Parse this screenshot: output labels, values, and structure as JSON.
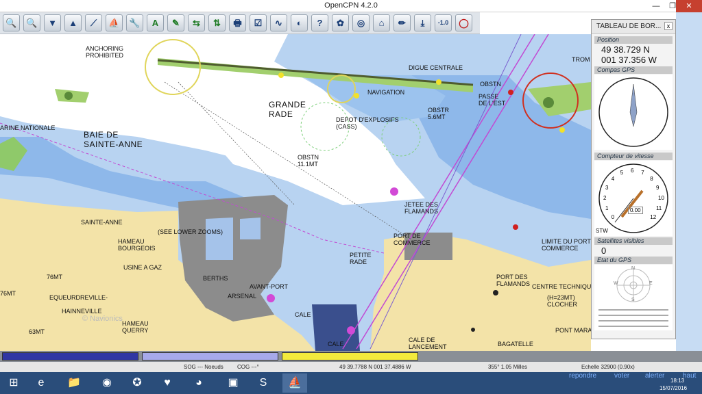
{
  "window": {
    "title": "OpenCPN 4.2.0",
    "minimize": "—",
    "maximize": "❐",
    "close": "✕"
  },
  "toolbar": [
    {
      "icon": "zoom-in-icon",
      "glyph": "🔍"
    },
    {
      "icon": "zoom-out-icon",
      "glyph": "🔍"
    },
    {
      "icon": "scale-in-icon",
      "glyph": "▼"
    },
    {
      "icon": "scale-out-icon",
      "glyph": "▲"
    },
    {
      "icon": "route-icon",
      "glyph": "⟋"
    },
    {
      "icon": "auto-follow-icon",
      "glyph": "⛵"
    },
    {
      "icon": "settings-icon",
      "glyph": "🔧"
    },
    {
      "icon": "text-icon",
      "glyph": "A"
    },
    {
      "icon": "tides-icon",
      "glyph": "✎"
    },
    {
      "icon": "currents-icon",
      "glyph": "⇆"
    },
    {
      "icon": "ais-icon",
      "glyph": "⇅"
    },
    {
      "icon": "print-icon",
      "glyph": "🖶"
    },
    {
      "icon": "route-manager-icon",
      "glyph": "☑"
    },
    {
      "icon": "track-icon",
      "glyph": "∿"
    },
    {
      "icon": "color-scheme-icon",
      "glyph": "◐"
    },
    {
      "icon": "help-icon",
      "glyph": "?"
    },
    {
      "icon": "plugin-icon",
      "glyph": "✿"
    },
    {
      "icon": "dashboard-icon",
      "glyph": "◎"
    },
    {
      "icon": "grib-icon",
      "glyph": "⌂"
    },
    {
      "icon": "measure-icon",
      "glyph": "✏"
    },
    {
      "icon": "download-icon",
      "glyph": "⤓"
    },
    {
      "icon": "version-icon",
      "glyph": "-1.0"
    },
    {
      "icon": "mob-icon",
      "glyph": "◯"
    }
  ],
  "chart_labels": {
    "anchoring": "ANCHORING\nPROHIBITED",
    "grande_rade": "GRANDE\nRADE",
    "baie": "BAIE DE\nSAINTE-ANNE",
    "marine": "ARINE NATIONALE",
    "digue": "DIGUE CENTRALE",
    "navigation": "NAVIGATION",
    "depot": "DEPOT D'EXPLOSIFS\n(CASS)",
    "obstn1": "OBSTN\n11.1MT",
    "obstr": "OBSTR\n5.6MT",
    "obstn2": "OBSTN",
    "passe": "PASSE\nDE L'EST",
    "sainte_anne": "SAINTE-ANNE",
    "see_lower": "(SEE LOWER ZOOMS)",
    "hameau_b": "HAMEAU\nBOURGEOIS",
    "usine": "USINE A GAZ",
    "berths": "BERTHS",
    "arsenal": "ARSENAL",
    "avant_port": "AVANT-PORT",
    "equeurdreville": "EQUEURDREVILLE-",
    "hainneville": "HAINNEVILLE",
    "hameau_q": "HAMEAU\nQUERRY",
    "mt76": "76MT",
    "mt63": "63MT",
    "mt76b": "76MT",
    "cale1": "CALE",
    "cale2": "CALE",
    "cale_lancement": "CALE DE\nLANCEMENT",
    "jetee": "JETEE DES\nFLAMANDS",
    "port_commerce": "PORT DE\nCOMMERCE",
    "petite_rade": "PETITE\nRADE",
    "limite": "LIMITE DU PORT DE\nCOMMERCE",
    "port_flamands": "PORT DES\nFLAMANDS",
    "centre_technique": "CENTRE TECHNIQUE",
    "clocher": "(H=23MT)\nCLOCHER",
    "pont_marais": "PONT MARAI",
    "bagatelle": "BAGATELLE",
    "navionics": "© Navionics",
    "troms": "TROM"
  },
  "dashboard": {
    "title": "TABLEAU DE BOR...",
    "close": "x",
    "position_caption": "Position",
    "lat": "49 38.729 N",
    "lon": "001 37.356 W",
    "compass_caption": "Compas GPS",
    "speed_caption": "Compteur de vitesse",
    "speed_value": "0.00",
    "stw_label": "STW",
    "sat_caption": "Satellites visibles",
    "sat_value": "0",
    "gps_caption": "Etat du GPS",
    "speed_ticks": [
      "0",
      "1",
      "2",
      "3",
      "4",
      "5",
      "6",
      "7",
      "8",
      "9",
      "10",
      "11",
      "12"
    ],
    "gps_letters": [
      "N",
      "E",
      "S",
      "W"
    ]
  },
  "color_bars": [
    "#3036a3",
    "#a7a9ea",
    "#f3ea3c"
  ],
  "status": {
    "sog": "SOG --- Noeuds",
    "cog": "COG ---°",
    "cursor": "49 39.7788 N   001 37.4886 W",
    "bearing": "355°  1.05 Milles",
    "scale": "Echelle 32900 (0.90x)"
  },
  "taskbar": {
    "apps": [
      "start-icon",
      "ie-icon",
      "explorer-icon",
      "media-icon",
      "compass-app-icon",
      "heart-app-icon",
      "chrome-icon",
      "remote-icon",
      "skype-icon",
      "opencpn-icon"
    ],
    "links": [
      "repondre",
      "voter",
      "alerter",
      "haut"
    ],
    "time": "18:13",
    "date": "15/07/2016"
  }
}
